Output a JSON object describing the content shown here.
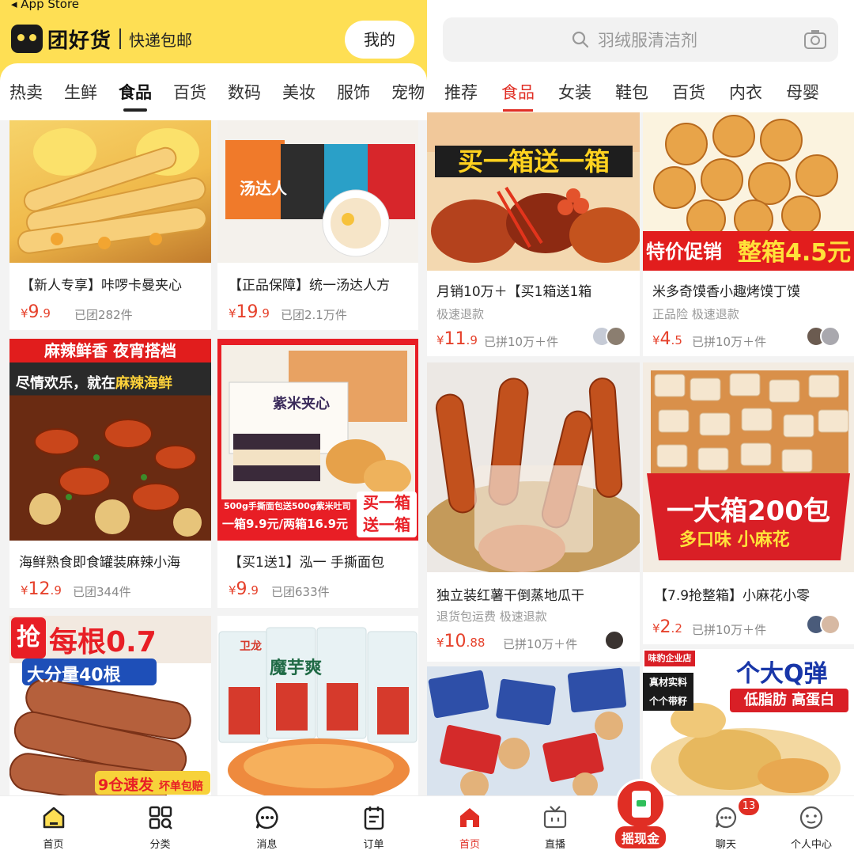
{
  "left_app": {
    "status_back": "◂ App Store",
    "brand": "团好货",
    "brand_sub": "快递包邮",
    "mine_button": "我的",
    "tabs": [
      "热卖",
      "生鲜",
      "食品",
      "百货",
      "数码",
      "美妆",
      "服饰",
      "宠物"
    ],
    "active_tab": "食品",
    "products": [
      {
        "title": "【新人专享】咔啰卡曼夹心",
        "price_sym": "¥",
        "price_int": "9",
        "price_dec": ".9",
        "sold": "已团282件"
      },
      {
        "title": "【正品保障】统一汤达人方",
        "price_sym": "¥",
        "price_int": "19",
        "price_dec": ".9",
        "sold": "已团2.1万件",
        "img_text": "汤达人"
      },
      {
        "title": "海鲜熟食即食罐装麻辣小海",
        "price_sym": "¥",
        "price_int": "12",
        "price_dec": ".9",
        "sold": "已团344件",
        "img_text": [
          "麻辣鲜香 夜宵搭档",
          "尽情欢乐，就在",
          "麻辣海鲜"
        ]
      },
      {
        "title": "【买1送1】泓一 手撕面包",
        "price_sym": "¥",
        "price_int": "9",
        "price_dec": ".9",
        "sold": "已团633件",
        "img_text": [
          "紫米夹心",
          "500g手撕面包送500g紫米吐司",
          "一箱9.9元/两箱16.9元",
          "买一箱",
          "送一箱"
        ]
      },
      {
        "img_text": [
          "抢",
          "每根0.7",
          "大分量40根",
          "9仓速发",
          "坏单包赔"
        ]
      },
      {
        "img_text": [
          "卫龙",
          "魔芋爽"
        ]
      }
    ],
    "nav": [
      {
        "label": "首页",
        "icon": "home-icon"
      },
      {
        "label": "分类",
        "icon": "category-icon"
      },
      {
        "label": "消息",
        "icon": "message-icon"
      },
      {
        "label": "订单",
        "icon": "order-icon"
      }
    ]
  },
  "right_app": {
    "search_placeholder": "羽绒服清洁剂",
    "tabs": [
      "推荐",
      "食品",
      "女装",
      "鞋包",
      "百货",
      "内衣",
      "母婴"
    ],
    "active_tab": "食品",
    "products": [
      {
        "title": "月销10万＋【买1箱送1箱",
        "tags": "极速退款",
        "price_sym": "¥",
        "price_int": "11",
        "price_dec": ".9",
        "sold": "已拼10万＋件",
        "img_text": "买一箱送一箱"
      },
      {
        "title": "米多奇馍香小趣烤馍丁馍",
        "tags": "正品险  极速退款",
        "price_sym": "¥",
        "price_int": "4",
        "price_dec": ".5",
        "sold": "已拼10万＋件",
        "img_text": [
          "特价促销",
          "整箱4.5元"
        ]
      },
      {
        "title": "独立装红薯干倒蒸地瓜干",
        "tags": "退货包运费  极速退款",
        "price_sym": "¥",
        "price_int": "10",
        "price_dec": ".88",
        "sold": "已拼10万＋件"
      },
      {
        "title": "【7.9抢整箱】小麻花小零",
        "tags": "",
        "price_sym": "¥",
        "price_int": "2",
        "price_dec": ".2",
        "sold": "已拼10万＋件",
        "img_text": [
          "一大箱200包",
          "多口味 小麻花"
        ]
      },
      {
        "img_text": []
      },
      {
        "img_text": [
          "味豹企业店",
          "个大Q弹",
          "真材实料",
          "个个带籽",
          "低脂肪 高蛋白"
        ]
      }
    ],
    "nav": [
      {
        "label": "首页",
        "icon": "home-icon"
      },
      {
        "label": "直播",
        "icon": "live-icon"
      },
      {
        "label": "摇现金",
        "icon": "red-packet-icon"
      },
      {
        "label": "聊天",
        "icon": "chat-icon",
        "badge": "13"
      },
      {
        "label": "个人中心",
        "icon": "profile-icon"
      }
    ]
  },
  "colors": {
    "brand_yellow": "#fedf54",
    "price_red": "#e6412b",
    "pdd_red": "#e02e24"
  }
}
